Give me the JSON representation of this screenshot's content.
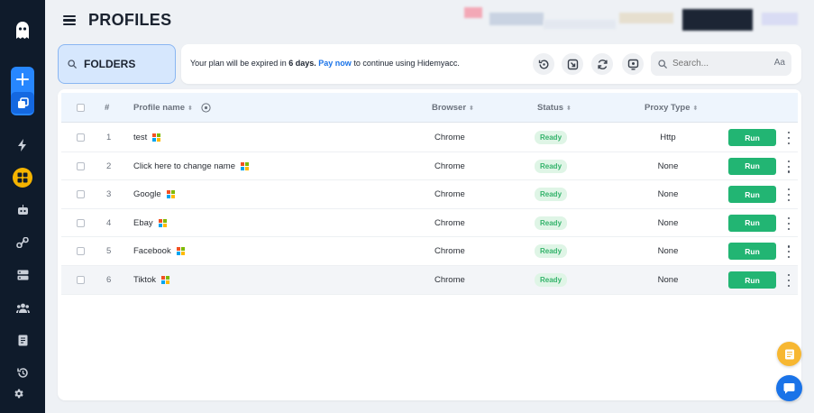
{
  "header": {
    "title": "PROFILES"
  },
  "folders": {
    "label": "FOLDERS"
  },
  "notice": {
    "prefix": "Your plan will be expired in ",
    "days": "6 days.",
    "link": "Pay now",
    "suffix": " to continue using Hidemyacc."
  },
  "search": {
    "placeholder": "Search...",
    "case_toggle": "Aa"
  },
  "table": {
    "headers": {
      "index": "#",
      "name": "Profile name",
      "browser": "Browser",
      "status": "Status",
      "proxy": "Proxy Type"
    },
    "run_label": "Run",
    "rows": [
      {
        "index": "1",
        "name": "test",
        "browser": "Chrome",
        "status": "Ready",
        "proxy": "Http"
      },
      {
        "index": "2",
        "name": "Click here to change name",
        "browser": "Chrome",
        "status": "Ready",
        "proxy": "None"
      },
      {
        "index": "3",
        "name": "Google",
        "browser": "Chrome",
        "status": "Ready",
        "proxy": "None"
      },
      {
        "index": "4",
        "name": "Ebay",
        "browser": "Chrome",
        "status": "Ready",
        "proxy": "None"
      },
      {
        "index": "5",
        "name": "Facebook",
        "browser": "Chrome",
        "status": "Ready",
        "proxy": "None"
      },
      {
        "index": "6",
        "name": "Tiktok",
        "browser": "Chrome",
        "status": "Ready",
        "proxy": "None"
      }
    ]
  },
  "colors": {
    "sidebar": "#0f1b2b",
    "accent": "#2787ff",
    "run": "#22b573",
    "ready_text": "#34b36b",
    "active_nav": "#f5b400"
  }
}
